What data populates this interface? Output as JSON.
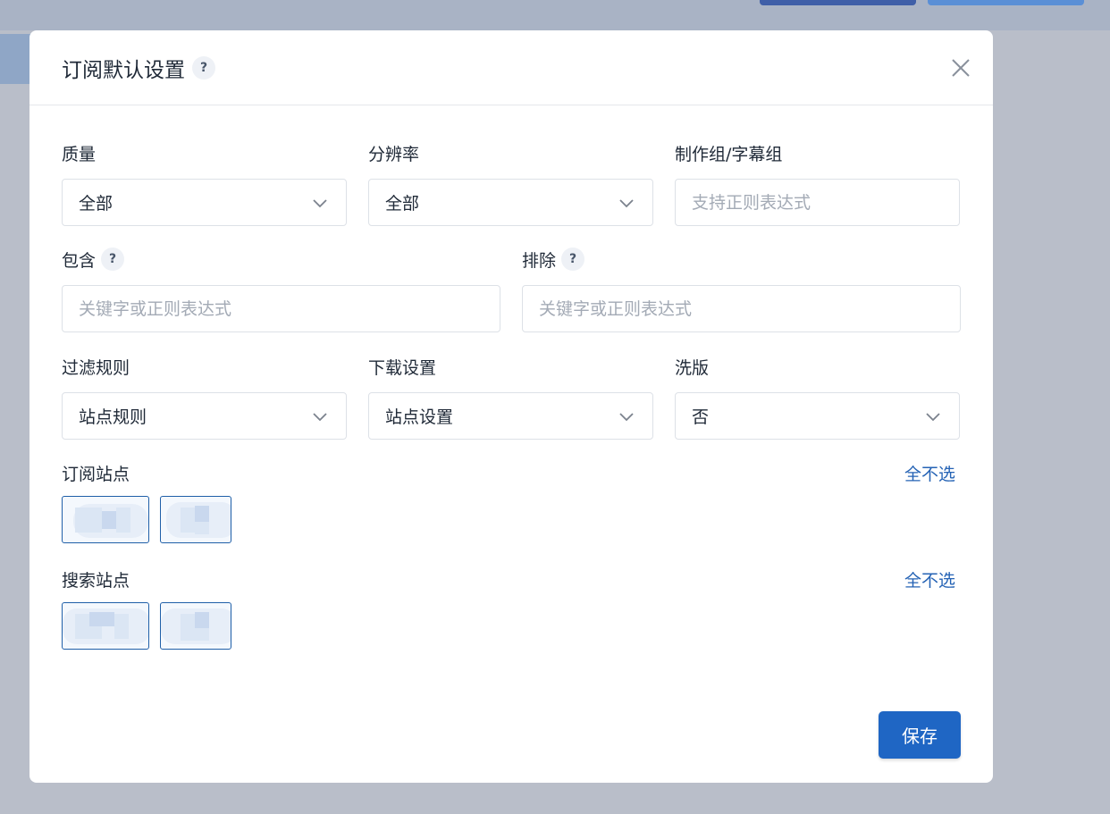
{
  "dialog": {
    "title": "订阅默认设置",
    "help_glyph": "?"
  },
  "fields": {
    "quality": {
      "label": "质量",
      "value": "全部"
    },
    "resolution": {
      "label": "分辨率",
      "value": "全部"
    },
    "release_group": {
      "label": "制作组/字幕组",
      "placeholder": "支持正则表达式"
    },
    "include": {
      "label": "包含",
      "placeholder": "关键字或正则表达式"
    },
    "exclude": {
      "label": "排除",
      "placeholder": "关键字或正则表达式"
    },
    "filter_rules": {
      "label": "过滤规则",
      "value": "站点规则"
    },
    "download_settings": {
      "label": "下载设置",
      "value": "站点设置"
    },
    "wash": {
      "label": "洗版",
      "value": "否"
    }
  },
  "subscribe_sites": {
    "label": "订阅站点",
    "deselect_all": "全不选"
  },
  "search_sites": {
    "label": "搜索站点",
    "deselect_all": "全不选"
  },
  "actions": {
    "save": "保存"
  },
  "colors": {
    "primary": "#1f66c4",
    "link": "#2563b5",
    "chip_border": "#1f5fa8"
  }
}
